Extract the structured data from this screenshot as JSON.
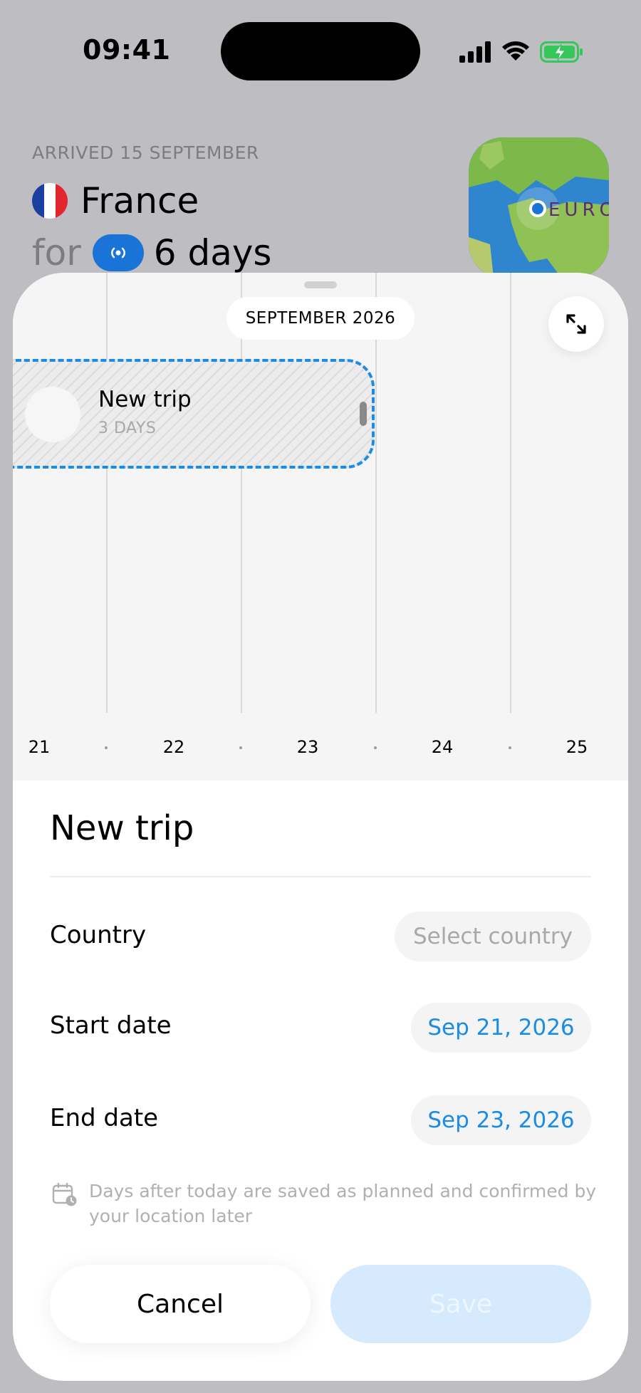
{
  "status_bar": {
    "time": "09:41"
  },
  "header": {
    "arrived": "ARRIVED 15 SEPTEMBER",
    "country": "France",
    "for_word": "for",
    "duration": "6 days",
    "map_label": "EURO"
  },
  "timeline": {
    "month": "SEPTEMBER 2026",
    "trip_title": "New trip",
    "trip_days": "3 DAYS",
    "days": [
      "21",
      "22",
      "23",
      "24",
      "25"
    ]
  },
  "form": {
    "title": "New trip",
    "country_label": "Country",
    "country_placeholder": "Select country",
    "start_label": "Start date",
    "start_value": "Sep 21, 2026",
    "end_label": "End date",
    "end_value": "Sep 23, 2026",
    "hint": "Days after today are saved as planned and confirmed by your location later",
    "cancel_label": "Cancel",
    "save_label": "Save"
  },
  "colors": {
    "accent": "#1a8ce8",
    "location_pill": "#1a74d8",
    "save_disabled": "#d6eafe",
    "date_text": "#1a8ce8",
    "placeholder_text": "#a8a8ab"
  },
  "icons": [
    "signal-icon",
    "wifi-icon",
    "battery-charging-icon",
    "location-broadcast-icon",
    "expand-icon",
    "calendar-clock-icon"
  ]
}
